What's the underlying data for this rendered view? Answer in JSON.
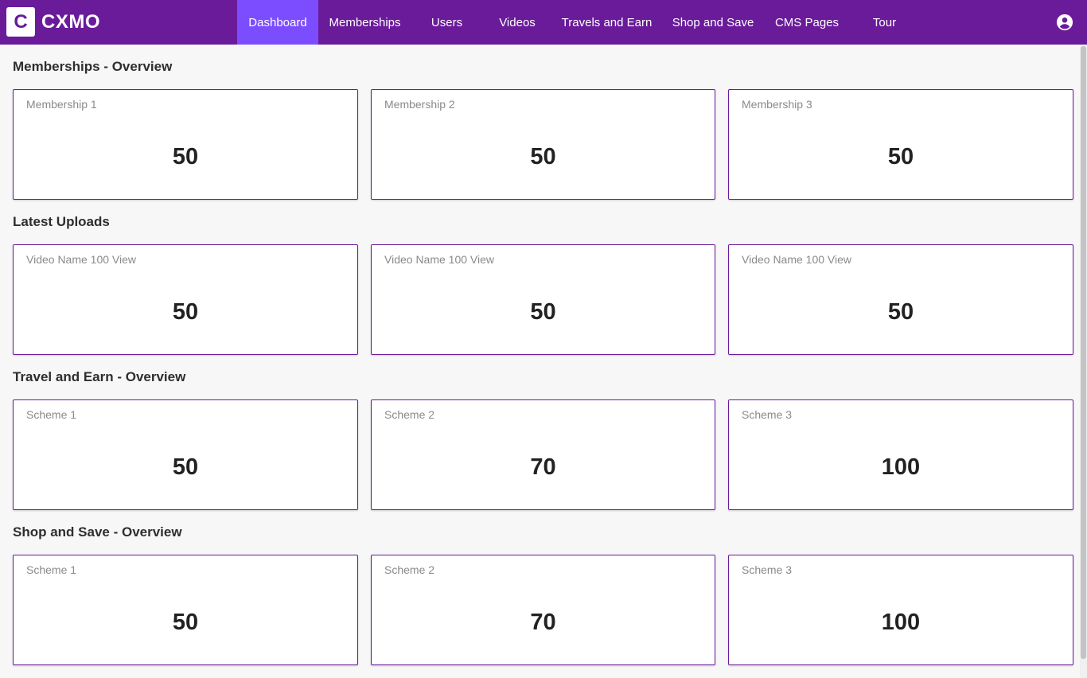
{
  "app": {
    "logo_letter": "C",
    "name": "CXMO"
  },
  "nav": {
    "items": [
      {
        "label": "Dashboard",
        "active": true
      },
      {
        "label": "Memberships",
        "active": false
      },
      {
        "label": "Users",
        "active": false
      },
      {
        "label": "Videos",
        "active": false
      },
      {
        "label": "Travels and Earn",
        "active": false
      },
      {
        "label": "Shop and Save",
        "active": false
      },
      {
        "label": "CMS Pages",
        "active": false
      },
      {
        "label": "Tour",
        "active": false
      }
    ],
    "profile_icon": "account-circle-icon"
  },
  "sections": [
    {
      "title": "Memberships - Overview",
      "cards": [
        {
          "label": "Membership 1",
          "value": "50"
        },
        {
          "label": "Membership 2",
          "value": "50"
        },
        {
          "label": "Membership 3",
          "value": "50"
        }
      ]
    },
    {
      "title": "Latest Uploads",
      "cards": [
        {
          "label": "Video Name 100 View",
          "value": "50"
        },
        {
          "label": "Video Name 100 View",
          "value": "50"
        },
        {
          "label": "Video Name 100 View",
          "value": "50"
        }
      ]
    },
    {
      "title": "Travel and Earn - Overview",
      "cards": [
        {
          "label": "Scheme 1",
          "value": "50"
        },
        {
          "label": "Scheme 2",
          "value": "70"
        },
        {
          "label": "Scheme 3",
          "value": "100"
        }
      ]
    },
    {
      "title": "Shop and Save - Overview",
      "cards": [
        {
          "label": "Scheme 1",
          "value": "50"
        },
        {
          "label": "Scheme 2",
          "value": "70"
        },
        {
          "label": "Scheme 3",
          "value": "100"
        }
      ]
    }
  ],
  "colors": {
    "header": "#6a1b9a",
    "active_nav": "#7c4dff",
    "card_border": "#6a1b9a",
    "background": "#f7f7f7"
  }
}
